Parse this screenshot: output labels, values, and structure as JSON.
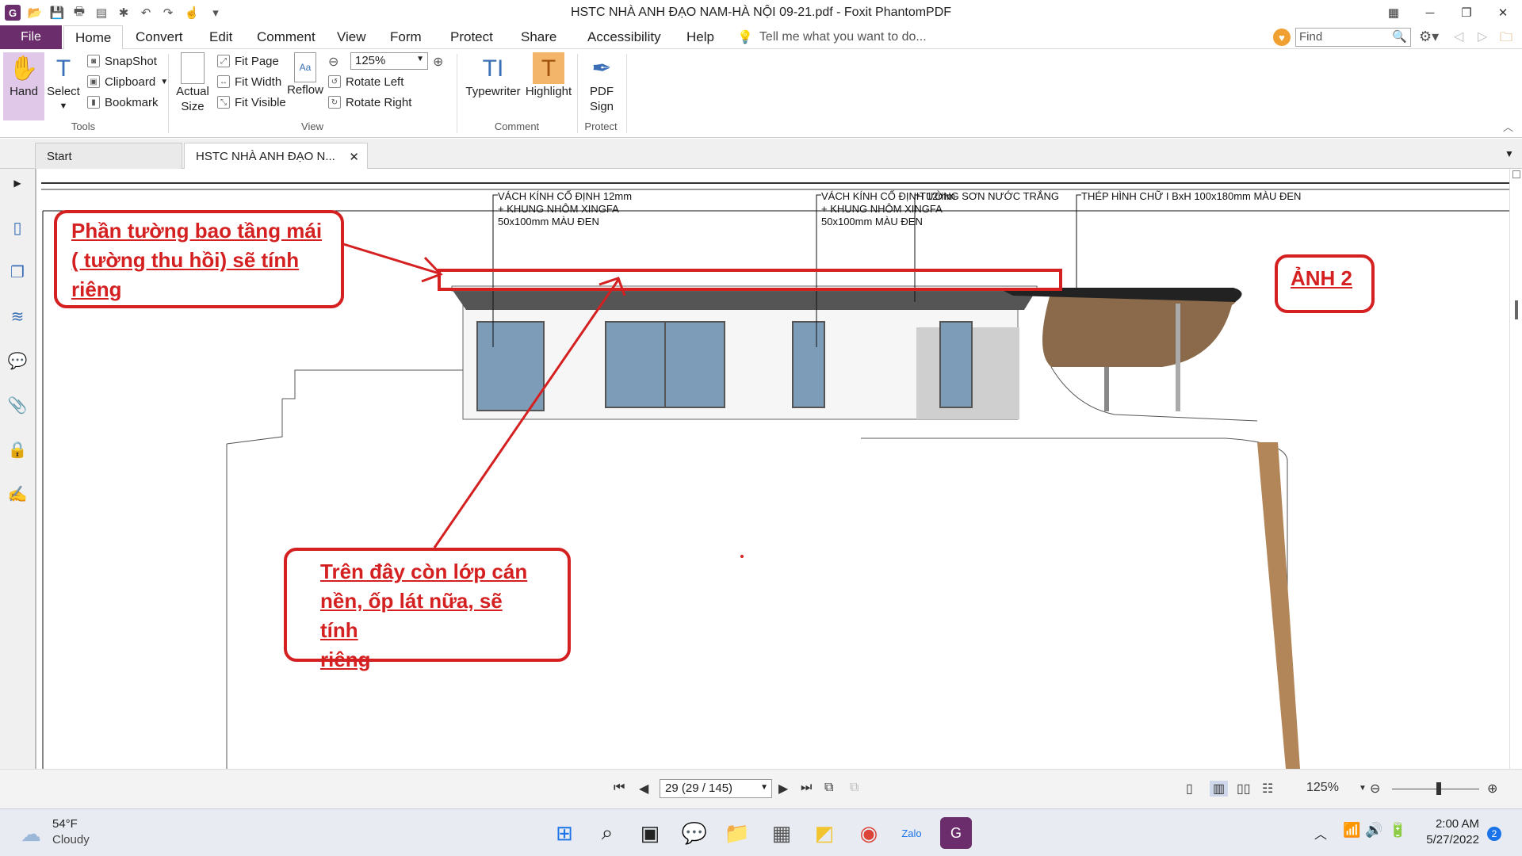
{
  "titlebar": {
    "title": "HSTC NHÀ ANH ĐẠO NAM-HÀ NỘI 09-21.pdf - Foxit PhantomPDF"
  },
  "menu": {
    "file_label": "File",
    "tabs": [
      "Home",
      "Convert",
      "Edit",
      "Comment",
      "View",
      "Form",
      "Protect",
      "Share",
      "Accessibility",
      "Help"
    ],
    "tell_placeholder": "Tell me what you want to do...",
    "find_placeholder": "Find"
  },
  "ribbon": {
    "hand": "Hand",
    "select": "Select",
    "snapshot": "SnapShot",
    "clipboard": "Clipboard",
    "bookmark": "Bookmark",
    "tools_group": "Tools",
    "actual": "Actual",
    "size": "Size",
    "fit_page": "Fit Page",
    "fit_width": "Fit Width",
    "fit_visible": "Fit Visible",
    "reflow": "Reflow",
    "zoom_value": "125%",
    "rotate_left": "Rotate Left",
    "rotate_right": "Rotate Right",
    "view_group": "View",
    "typewriter": "Typewriter",
    "highlight": "Highlight",
    "comment_group": "Comment",
    "pdf": "PDF",
    "sign": "Sign",
    "protect_group": "Protect"
  },
  "doctabs": {
    "start": "Start",
    "document": "HSTC NHÀ ANH ĐẠO N..."
  },
  "drawing": {
    "label1_lines": [
      "VÁCH KÍNH CỐ ĐỊNH 12mm",
      "+ KHUNG NHÔM XINGFA",
      "50x100mm MÀU ĐEN"
    ],
    "label2_lines": [
      "VÁCH KÍNH CỐ ĐỊNH 12mm",
      "+ KHUNG NHÔM XINGFA",
      "50x100mm MÀU ĐEN"
    ],
    "label3": "TƯỜNG SƠN NƯỚC TRẮNG",
    "label4": "THÉP HÌNH CHỮ I BxH 100x180mm MÀU ĐEN",
    "note_roof_lines": [
      "Phần tường bao tầng mái",
      "( tường thu hồi) sẽ tính",
      "riêng"
    ],
    "note_floor_lines": [
      "Trên đây còn lớp cán",
      "nền, ốp lát nữa, sẽ tính",
      "riêng"
    ],
    "photo_label": "ẢNH 2",
    "accent": "#d42020"
  },
  "statusbar": {
    "page_value": "29 (29 / 145)",
    "zoom": "125%"
  },
  "taskbar": {
    "weather_temp": "54°F",
    "weather_desc": "Cloudy",
    "time": "2:00 AM",
    "date": "5/27/2022",
    "notifications": "2"
  }
}
